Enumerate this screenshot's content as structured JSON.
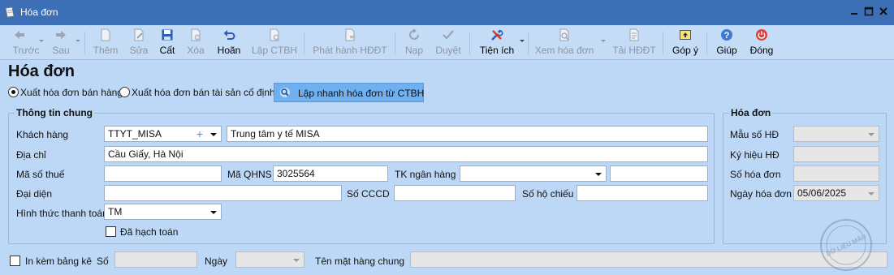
{
  "window": {
    "title": "Hóa đơn"
  },
  "toolbar": {
    "prev": "Trước",
    "next": "Sau",
    "add": "Thêm",
    "edit": "Sửa",
    "save": "Cất",
    "delete": "Xóa",
    "undo": "Hoãn",
    "create_ctbh": "Lập CTBH",
    "issue_einvoice": "Phát hành HĐĐT",
    "load": "Nạp",
    "approve": "Duyệt",
    "utilities": "Tiện ích",
    "view_invoice": "Xem hóa đơn",
    "download_einvoice": "Tải HĐĐT",
    "feedback": "Góp ý",
    "help": "Giúp",
    "close": "Đóng"
  },
  "page": {
    "title": "Hóa đơn",
    "radio_sales": "Xuất hóa đơn bán hàng",
    "radio_fixed_assets": "Xuất hóa đơn bán tài sản cố định",
    "quick_button": "Lập nhanh hóa đơn từ CTBH"
  },
  "general": {
    "legend": "Thông tin chung",
    "customer_label": "Khách hàng",
    "customer_code": "TTYT_MISA",
    "customer_name": "Trung tâm y tế MISA",
    "address_label": "Địa chỉ",
    "address": "Cầu Giấy, Hà Nội",
    "tax_code_label": "Mã số thuế",
    "tax_code": "",
    "qhns_label": "Mã QHNS",
    "qhns": "3025564",
    "bank_account_label": "TK ngân hàng",
    "bank_account": "",
    "bank_name": "",
    "representative_label": "Đại diện",
    "representative": "",
    "id_card_label": "Số CCCD",
    "id_card": "",
    "passport_label": "Số hộ chiếu",
    "passport": "",
    "payment_method_label": "Hình thức thanh toán",
    "payment_method": "TM",
    "posted_label": "Đã hạch toán"
  },
  "invoice": {
    "legend": "Hóa đơn",
    "template_label": "Mẫu số HĐ",
    "template": "",
    "series_label": "Ký hiệu HĐ",
    "series": "",
    "number_label": "Số hóa đơn",
    "number": "",
    "date_label": "Ngày hóa đơn",
    "date": "05/06/2025"
  },
  "footer": {
    "attach_list_label": "In kèm bảng kê",
    "no_label": "Số",
    "no_value": "",
    "date_label": "Ngày",
    "date_value": "",
    "common_item_label": "Tên mặt hàng chung",
    "common_item_value": ""
  },
  "watermark_text": "DỮ LIỆU MẪU"
}
